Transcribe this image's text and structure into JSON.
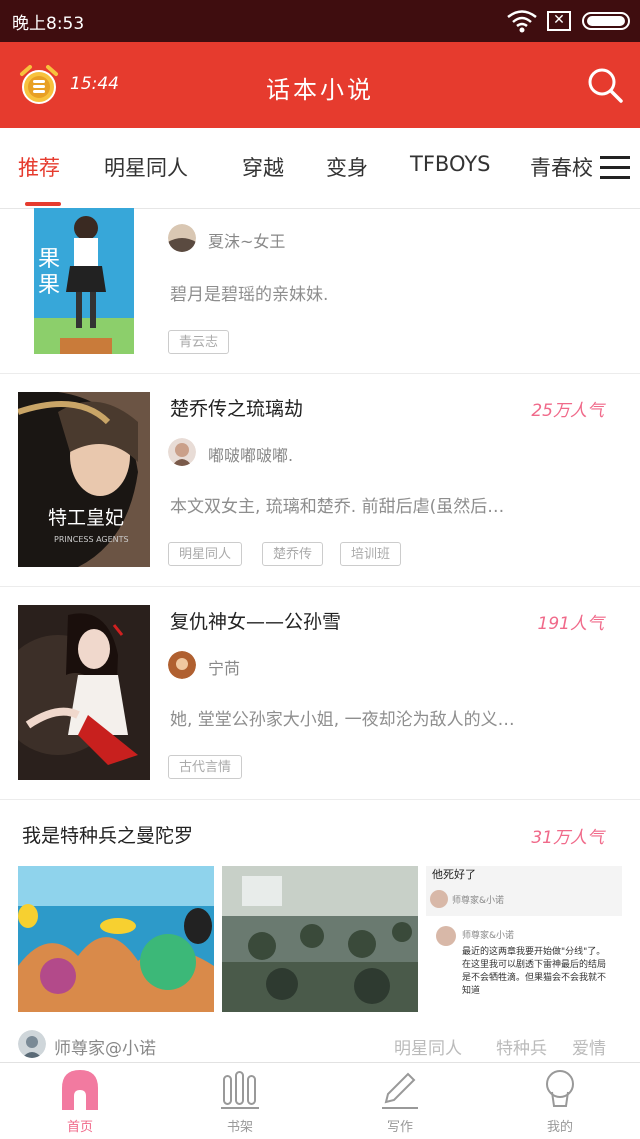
{
  "status_bar": {
    "time": "晚上8:53"
  },
  "header": {
    "timer": "15:44",
    "title": "话本小说"
  },
  "tabs": [
    "推荐",
    "明星同人",
    "穿越",
    "变身",
    "TFBOYS",
    "青春校"
  ],
  "books": [
    {
      "author": "夏沫~女王",
      "description": "碧月是碧瑶的亲妹妹.",
      "tags": [
        "青云志"
      ]
    },
    {
      "title": "楚乔传之琉璃劫",
      "popularity": "25万人气",
      "author": "嘟啵嘟啵嘟.",
      "description": "本文双女主, 琉璃和楚乔. 前甜后虐(虽然后…",
      "tags": [
        "明星同人",
        "楚乔传",
        "培训班"
      ]
    },
    {
      "title": "复仇神女——公孙雪",
      "popularity": "191人气",
      "author": "宁苘",
      "description": "她, 堂堂公孙家大小姐, 一夜却沦为敌人的义…",
      "tags": [
        "古代言情"
      ]
    }
  ],
  "wide_book": {
    "title": "我是特种兵之曼陀罗",
    "popularity": "31万人气",
    "author": "师尊家@小诺",
    "tags": [
      "明星同人",
      "特种兵",
      "爱情"
    ],
    "chat_preview": {
      "header": "他死好了",
      "user": "师尊家&小诺",
      "body": "最近的这两章我要开始做\"分线\"了。在这里我可以剧透下雷神最后的结局是不会牺牲滴。但果猫会不会我就不知道"
    }
  },
  "bottom_nav": [
    "首页",
    "书架",
    "写作",
    "我的"
  ]
}
